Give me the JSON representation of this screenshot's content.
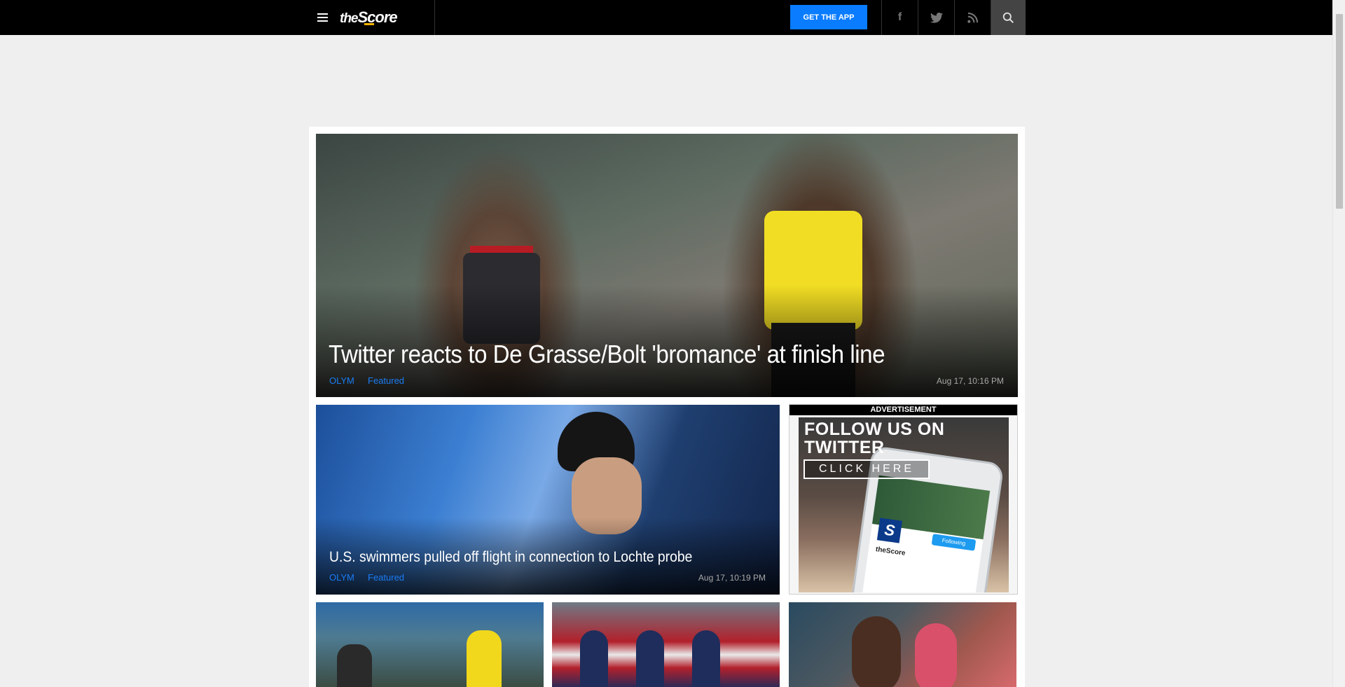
{
  "nav": {
    "logo_the": "the",
    "logo_score": "Score",
    "get_app_label": "GET THE APP",
    "social": {
      "facebook_glyph": "f",
      "twitter_icon": "twitter-icon",
      "rss_icon": "rss-icon",
      "search_icon": "search-icon"
    }
  },
  "hero": {
    "title": "Twitter reacts to De Grasse/Bolt 'bromance' at finish line",
    "tags": [
      "OLYM",
      "Featured"
    ],
    "timestamp": "Aug 17, 10:16 PM"
  },
  "secondary": {
    "title": "U.S. swimmers pulled off flight in connection to Lochte probe",
    "tags": [
      "OLYM",
      "Featured"
    ],
    "timestamp": "Aug 17, 10:19 PM"
  },
  "ad": {
    "label": "ADVERTISEMENT",
    "line1": "FOLLOW US ON",
    "line2": "TWITTER",
    "button": "CLICK HERE",
    "phone_logo": "S",
    "phone_follow": "Following",
    "phone_name": "theScore"
  },
  "colors": {
    "accent": "#0a7cff",
    "tag": "#1a7cf5",
    "topbar": "#000000",
    "background": "#efefef"
  }
}
